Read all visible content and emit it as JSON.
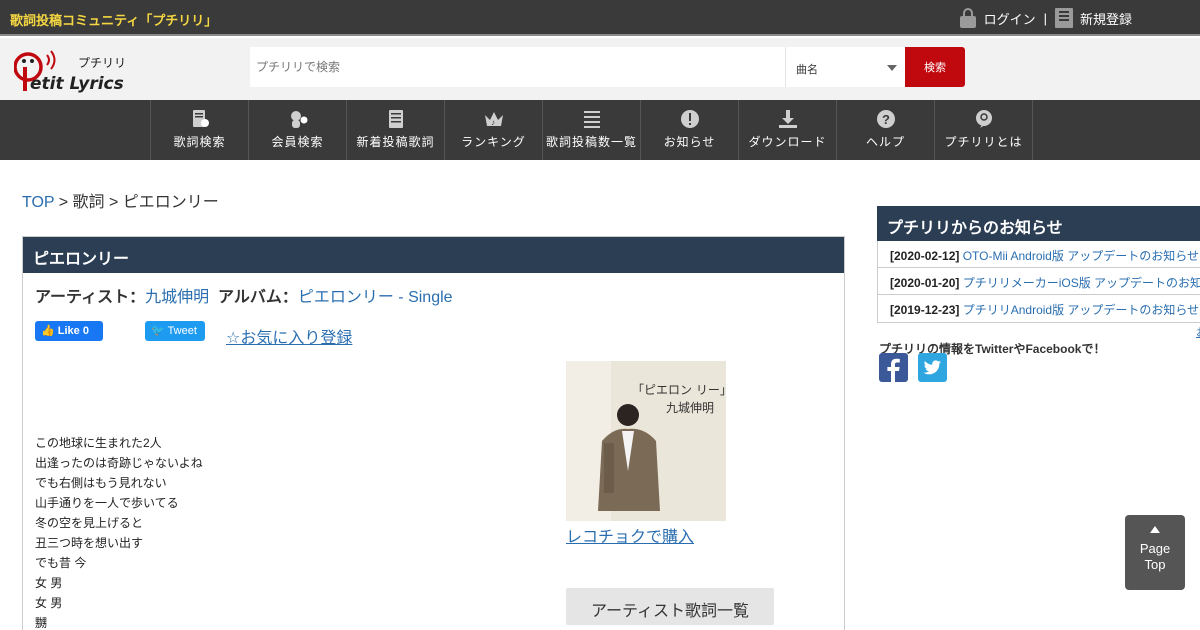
{
  "topbar": {
    "tagline": "歌詞投稿コミュニティ「プチリリ」",
    "login": "ログイン",
    "separator": "|",
    "register": "新規登録"
  },
  "header": {
    "logo_text_main": "etit Lyrics",
    "logo_text_kana": "プチリリ",
    "search_placeholder": "プチリリで検索",
    "search_type": "曲名",
    "search_button": "検索"
  },
  "nav": {
    "items": [
      {
        "label": "歌詞検索",
        "icon": "search-lyrics-icon"
      },
      {
        "label": "会員検索",
        "icon": "member-search-icon"
      },
      {
        "label": "新着投稿歌詞",
        "icon": "new-lyrics-icon"
      },
      {
        "label": "ランキング",
        "icon": "ranking-crown-icon"
      },
      {
        "label": "歌詞投稿数一覧",
        "icon": "list-icon"
      },
      {
        "label": "お知らせ",
        "icon": "notice-icon"
      },
      {
        "label": "ダウンロード",
        "icon": "download-icon"
      },
      {
        "label": "ヘルプ",
        "icon": "help-icon"
      },
      {
        "label": "プチリリとは",
        "icon": "about-icon"
      }
    ]
  },
  "breadcrumb": {
    "top": "TOP",
    "sep1": " > ",
    "lyrics": "歌詞",
    "sep2": " > ",
    "current": "ピエロンリー"
  },
  "song": {
    "title": "ピエロンリー",
    "artist_label": "アーティスト：",
    "artist": "九城伸明",
    "album_label": "アルバム：",
    "album": "ピエロンリー - Single",
    "fb_like": "Like 0",
    "tweet": "Tweet",
    "favorite": "☆お気に入り登録",
    "lyrics_lines": [
      "この地球に生まれた2人",
      "出逢ったのは奇跡じゃないよね",
      "でも右側はもう見れない",
      "山手通りを一人で歩いてる",
      "冬の空を見上げると",
      "丑三つ時を想い出す",
      "でも昔 今",
      "女 男",
      "女 男",
      "嬲"
    ],
    "cover_title": "「ピエロン リー」",
    "cover_artist": "九城伸明",
    "buy_link": "レコチョクで購入",
    "artist_lyrics_button": "アーティスト歌詞一覧"
  },
  "sidebar": {
    "news_title": "プチリリからのお知らせ",
    "news": [
      {
        "date": "[2020-02-12]",
        "text": "OTO-Mii Android版 アップデートのお知らせ"
      },
      {
        "date": "[2020-01-20]",
        "text": "プチリリメーカーiOS版 アップデートのお知らせ"
      },
      {
        "date": "[2019-12-23]",
        "text": "プチリリAndroid版 アップデートのお知らせ"
      }
    ],
    "more_fragment": "お",
    "social_text": "プチリリの情報をTwitterやFacebookで！"
  },
  "page_top": {
    "line1": "Page",
    "line2": "Top"
  },
  "colors": {
    "topbar_bg": "#3a3a3a",
    "tagline": "#f5d742",
    "search_button": "#c0080f",
    "panel_head": "#2c3e54",
    "link": "#2a6eb0"
  }
}
